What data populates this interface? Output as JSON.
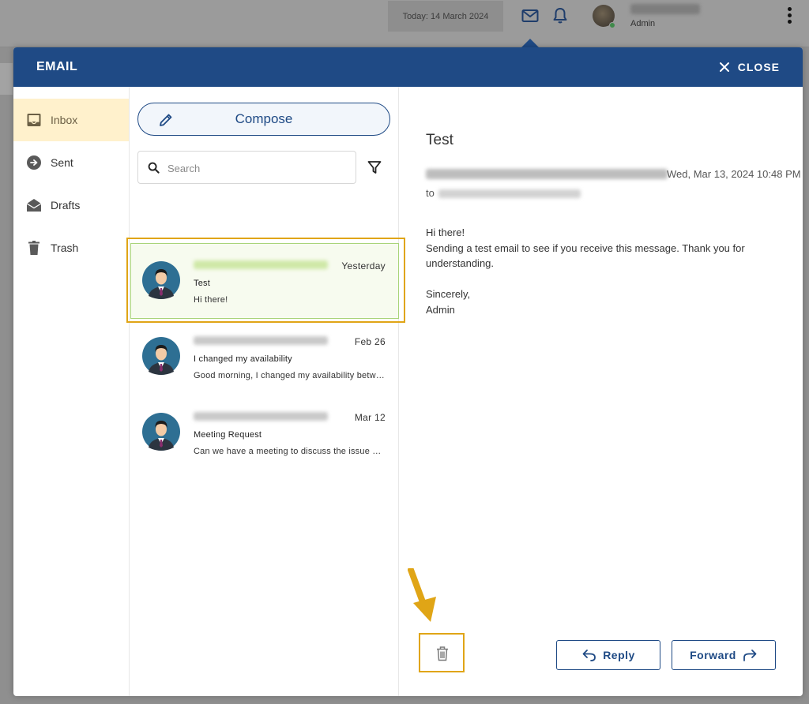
{
  "topbar": {
    "today": "Today: 14 March 2024",
    "user_role": "Admin",
    "icons": [
      "mail-icon",
      "bell-icon",
      "more-vertical-icon"
    ]
  },
  "modal": {
    "title": "EMAIL",
    "close_label": "CLOSE"
  },
  "sidebar": {
    "items": [
      {
        "label": "Inbox",
        "icon": "inbox-icon",
        "active": true
      },
      {
        "label": "Sent",
        "icon": "sent-icon",
        "active": false
      },
      {
        "label": "Drafts",
        "icon": "drafts-icon",
        "active": false
      },
      {
        "label": "Trash",
        "icon": "trash-icon",
        "active": false
      }
    ]
  },
  "list": {
    "compose_label": "Compose",
    "search_placeholder": "Search",
    "messages": [
      {
        "date": "Yesterday",
        "subject": "Test",
        "preview": "Hi there!",
        "selected": true
      },
      {
        "date": "Feb 26",
        "subject": "I changed my availability",
        "preview": "Good morning, I changed my availability between",
        "selected": false
      },
      {
        "date": "Mar 12",
        "subject": "Meeting Request",
        "preview": "Can we have a meeting to discuss the issue with",
        "selected": false
      }
    ]
  },
  "reader": {
    "subject": "Test",
    "date": "Wed, Mar 13, 2024 10:48 PM",
    "to_label": "to",
    "body": [
      "Hi there!",
      "Sending a test email to see if you receive this message. Thank you for understanding.",
      "",
      "Sincerely,",
      "Admin"
    ],
    "reply_label": "Reply",
    "forward_label": "Forward"
  },
  "colors": {
    "header": "#1f4a85",
    "active_nav": "#fff1cc",
    "highlight": "#e0a516",
    "selected_bg": "#f7fbef"
  }
}
